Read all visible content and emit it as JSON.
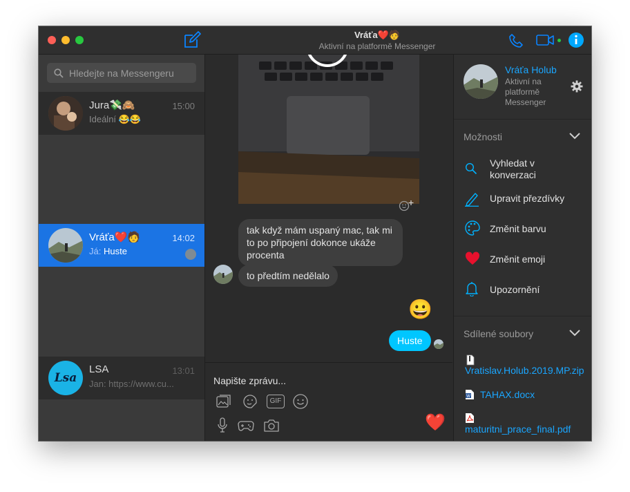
{
  "header": {
    "contact_name": "Vráťa❤️🧑",
    "status": "Aktivní na platformě Messenger"
  },
  "sidebar": {
    "search_placeholder": "Hledejte na Messengeru",
    "conversations": [
      {
        "name": "Jura💸🙈",
        "time": "15:00",
        "preview": "Ideální 😂😂",
        "preview_prefix": ""
      },
      {
        "name": "Vráťa❤️🧑",
        "time": "14:02",
        "preview": "Huste",
        "preview_prefix": "Já: "
      },
      {
        "name": "LSA",
        "time": "13:01",
        "preview": "Jan: https://www.cu...",
        "preview_prefix": "",
        "avatar_text": "Lsa"
      }
    ]
  },
  "chat": {
    "messages": [
      {
        "from": "them",
        "text": "tak když mám uspaný mac, tak mi to po připojení dokonce ukáže procenta"
      },
      {
        "from": "them",
        "text": "to předtím nedělalo"
      },
      {
        "from": "me",
        "emoji": "😀"
      },
      {
        "from": "me",
        "text": "Huste"
      }
    ],
    "composer_placeholder": "Napište zprávu...",
    "gif_label": "GIF",
    "like_emoji": "❤️"
  },
  "info_panel": {
    "name": "Vráťa Holub",
    "status": "Aktivní na platformě Messenger",
    "options_title": "Možnosti",
    "options": [
      {
        "icon": "search-icon",
        "label": "Vyhledat v konverzaci"
      },
      {
        "icon": "pencil-icon",
        "label": "Upravit přezdívky"
      },
      {
        "icon": "palette-icon",
        "label": "Změnit barvu"
      },
      {
        "icon": "heart-icon",
        "label": "Změnit emoji"
      },
      {
        "icon": "bell-icon",
        "label": "Upozornění"
      }
    ],
    "files_title": "Sdílené soubory",
    "files": [
      {
        "icon": "zip-file-icon",
        "name": "Vratislav.Holub.2019.MP.zip"
      },
      {
        "icon": "word-file-icon",
        "name": "TAHAX.docx"
      },
      {
        "icon": "pdf-file-icon",
        "name": "maturitni_prace_final.pdf"
      }
    ]
  },
  "colors": {
    "accent": "#0a84ff",
    "selected_row": "#1b74e4",
    "my_bubble": "#00c6ff",
    "online_dot": "#28c840"
  }
}
